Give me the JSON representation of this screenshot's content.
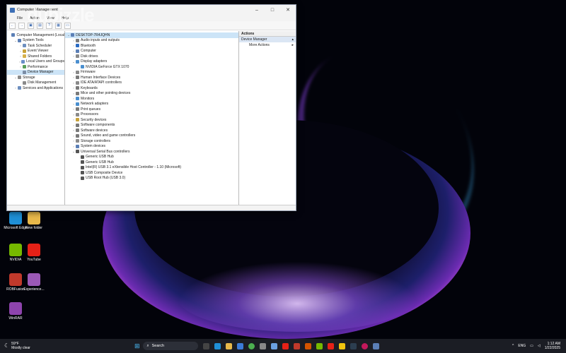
{
  "window": {
    "title": "Computer Management",
    "menu": [
      "File",
      "Action",
      "View",
      "Help"
    ]
  },
  "left_tree": [
    {
      "label": "Computer Management (Local",
      "indent": 0,
      "arrow": "",
      "color": "#5b7fb6"
    },
    {
      "label": "System Tools",
      "indent": 1,
      "arrow": "⌄",
      "color": "#5b7fb6"
    },
    {
      "label": "Task Scheduler",
      "indent": 2,
      "arrow": "›",
      "color": "#6d8fbf"
    },
    {
      "label": "Event Viewer",
      "indent": 2,
      "arrow": "›",
      "color": "#c9a33a"
    },
    {
      "label": "Shared Folders",
      "indent": 2,
      "arrow": "›",
      "color": "#d6b04a"
    },
    {
      "label": "Local Users and Groups",
      "indent": 2,
      "arrow": "›",
      "color": "#6a8fc8"
    },
    {
      "label": "Performance",
      "indent": 2,
      "arrow": "›",
      "color": "#5aa05a"
    },
    {
      "label": "Device Manager",
      "indent": 2,
      "arrow": "",
      "color": "#7b8da6",
      "selected": true
    },
    {
      "label": "Storage",
      "indent": 1,
      "arrow": "⌄",
      "color": "#8a8a8a"
    },
    {
      "label": "Disk Management",
      "indent": 2,
      "arrow": "",
      "color": "#8a8a8a"
    },
    {
      "label": "Services and Applications",
      "indent": 1,
      "arrow": "›",
      "color": "#6d8fbf"
    }
  ],
  "device_tree": [
    {
      "label": "DESKTOP-7R4JQHN",
      "indent": 0,
      "arrow": "⌄",
      "color": "#5b7fb6",
      "selected": true
    },
    {
      "label": "Audio inputs and outputs",
      "indent": 1,
      "arrow": "›",
      "color": "#7a7a7a"
    },
    {
      "label": "Bluetooth",
      "indent": 1,
      "arrow": "›",
      "color": "#2b6cc4"
    },
    {
      "label": "Computer",
      "indent": 1,
      "arrow": "›",
      "color": "#5b7fb6"
    },
    {
      "label": "Disk drives",
      "indent": 1,
      "arrow": "›",
      "color": "#8a8a8a"
    },
    {
      "label": "Display adapters",
      "indent": 1,
      "arrow": "⌄",
      "color": "#4a8fcf"
    },
    {
      "label": "NVIDIA GeForce GTX 1070",
      "indent": 2,
      "arrow": "",
      "color": "#4a8fcf"
    },
    {
      "label": "Firmware",
      "indent": 1,
      "arrow": "›",
      "color": "#8a8a8a"
    },
    {
      "label": "Human Interface Devices",
      "indent": 1,
      "arrow": "›",
      "color": "#7a7a7a"
    },
    {
      "label": "IDE ATA/ATAPI controllers",
      "indent": 1,
      "arrow": "›",
      "color": "#8a8a8a"
    },
    {
      "label": "Keyboards",
      "indent": 1,
      "arrow": "›",
      "color": "#7a7a7a"
    },
    {
      "label": "Mice and other pointing devices",
      "indent": 1,
      "arrow": "›",
      "color": "#7a7a7a"
    },
    {
      "label": "Monitors",
      "indent": 1,
      "arrow": "›",
      "color": "#4a8fcf"
    },
    {
      "label": "Network adapters",
      "indent": 1,
      "arrow": "›",
      "color": "#4a8fcf"
    },
    {
      "label": "Print queues",
      "indent": 1,
      "arrow": "›",
      "color": "#7a7a7a"
    },
    {
      "label": "Processors",
      "indent": 1,
      "arrow": "›",
      "color": "#8a8a8a"
    },
    {
      "label": "Security devices",
      "indent": 1,
      "arrow": "›",
      "color": "#c9a33a"
    },
    {
      "label": "Software components",
      "indent": 1,
      "arrow": "›",
      "color": "#7a7a7a"
    },
    {
      "label": "Software devices",
      "indent": 1,
      "arrow": "›",
      "color": "#7a7a7a"
    },
    {
      "label": "Sound, video and game controllers",
      "indent": 1,
      "arrow": "›",
      "color": "#7a7a7a"
    },
    {
      "label": "Storage controllers",
      "indent": 1,
      "arrow": "›",
      "color": "#8a8a8a"
    },
    {
      "label": "System devices",
      "indent": 1,
      "arrow": "›",
      "color": "#5b7fb6"
    },
    {
      "label": "Universal Serial Bus controllers",
      "indent": 1,
      "arrow": "⌄",
      "color": "#555555"
    },
    {
      "label": "Generic USB Hub",
      "indent": 2,
      "arrow": "",
      "color": "#555555"
    },
    {
      "label": "Generic USB Hub",
      "indent": 2,
      "arrow": "",
      "color": "#555555"
    },
    {
      "label": "Intel(R) USB 3.1 eXtensible Host Controller - 1.10 (Microsoft)",
      "indent": 2,
      "arrow": "",
      "color": "#555555"
    },
    {
      "label": "USB Composite Device",
      "indent": 2,
      "arrow": "",
      "color": "#555555"
    },
    {
      "label": "USB Root Hub (USB 3.0)",
      "indent": 2,
      "arrow": "",
      "color": "#555555"
    }
  ],
  "actions": {
    "title": "Actions",
    "section": "Device Manager",
    "more": "More Actions"
  },
  "desktop_icons": [
    {
      "label": "Microsoft Edge",
      "color": "#1f8fd6"
    },
    {
      "label": "New folder",
      "color": "#e8b84a"
    },
    {
      "label": "NVIDIA",
      "color": "#76b900"
    },
    {
      "label": "YouTube",
      "color": "#e62117"
    },
    {
      "label": "ROBFusion",
      "color": "#c0392b"
    },
    {
      "label": "Experience...",
      "color": "#9b59b6"
    },
    {
      "label": "WinRAR",
      "color": "#8e44ad"
    }
  ],
  "watermark": "dubizzle",
  "taskbar": {
    "weather_temp": "59°F",
    "weather_desc": "Mostly clear",
    "search_label": "Search",
    "lang": "ENG",
    "time": "1:12 AM",
    "date": "1/22/2025"
  }
}
